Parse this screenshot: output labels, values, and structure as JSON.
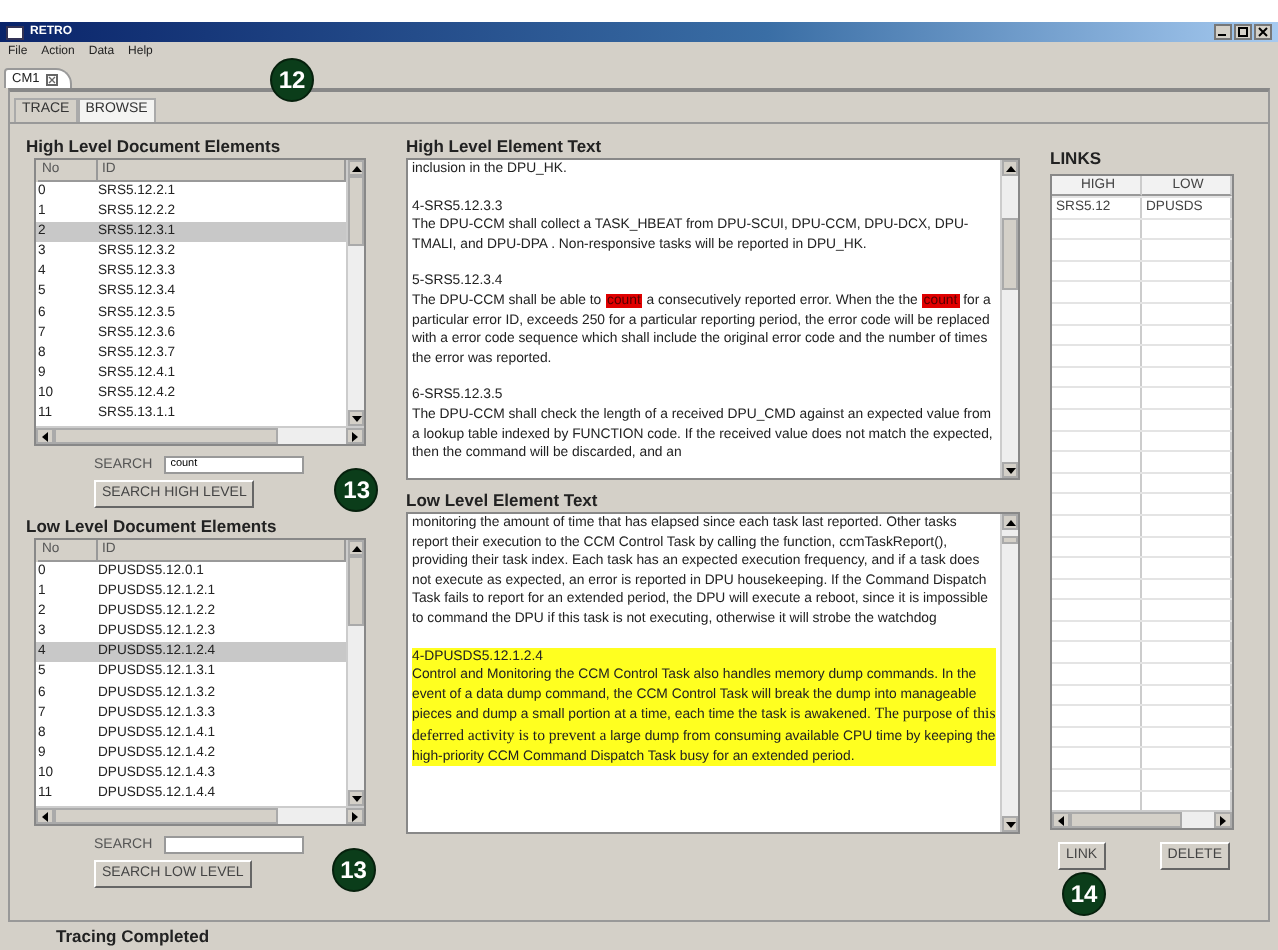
{
  "window": {
    "title": "RETRO"
  },
  "menu": [
    "File",
    "Action",
    "Data",
    "Help"
  ],
  "document_tabs": [
    {
      "label": "CM1",
      "selected": true
    }
  ],
  "document_tabs_callout": "12",
  "view_tabs": [
    {
      "label": "TRACE",
      "selected": false
    },
    {
      "label": "BROWSE",
      "selected": true
    }
  ],
  "high_level": {
    "heading": "High Level Document Elements",
    "columns": [
      "No",
      "ID"
    ],
    "rows": [
      {
        "no": "0",
        "id": "SRS5.12.2.1",
        "selected": false
      },
      {
        "no": "1",
        "id": "SRS5.12.2.2",
        "selected": false
      },
      {
        "no": "2",
        "id": "SRS5.12.3.1",
        "selected": true
      },
      {
        "no": "3",
        "id": "SRS5.12.3.2",
        "selected": false
      },
      {
        "no": "4",
        "id": "SRS5.12.3.3",
        "selected": false
      },
      {
        "no": "5",
        "id": "SRS5.12.3.4",
        "selected": false
      },
      {
        "no": "6",
        "id": "SRS5.12.3.5",
        "selected": false
      },
      {
        "no": "7",
        "id": "SRS5.12.3.6",
        "selected": false
      },
      {
        "no": "8",
        "id": "SRS5.12.3.7",
        "selected": false
      },
      {
        "no": "9",
        "id": "SRS5.12.4.1",
        "selected": false
      },
      {
        "no": "10",
        "id": "SRS5.12.4.2",
        "selected": false
      },
      {
        "no": "11",
        "id": "SRS5.13.1.1",
        "selected": false
      }
    ],
    "search_label": "SEARCH",
    "search_value": "count",
    "button": "SEARCH HIGH LEVEL",
    "callout": "13"
  },
  "high_text": {
    "heading": "High Level Element Text",
    "paragraphs": [
      {
        "selected": false,
        "segments": [
          {
            "kind": "plain",
            "text": "inclusion in the DPU_HK."
          }
        ]
      },
      {
        "selected": false,
        "heading": "4-SRS5.12.3.3",
        "segments": [
          {
            "kind": "plain",
            "text": "The DPU-CCM shall collect a TASK_HBEAT from  DPU-SCUI, DPU-CCM, DPU-DCX, DPU-TMALI, and DPU-DPA .  Non-responsive tasks will be reported in DPU_HK."
          }
        ]
      },
      {
        "selected": false,
        "heading": "5-SRS5.12.3.4",
        "segments": [
          {
            "kind": "plain",
            "text": "The DPU-CCM shall be able to "
          },
          {
            "kind": "match",
            "text": "count"
          },
          {
            "kind": "plain",
            "text": " a consecutively reported error.  When the the "
          },
          {
            "kind": "match",
            "text": "count"
          },
          {
            "kind": "plain",
            "text": " for a particular error ID, exceeds 250 for a particular reporting period, the error code will be replaced with a error code sequence which shall include the original error code and the number of times the error was reported."
          }
        ]
      },
      {
        "selected": false,
        "heading": "6-SRS5.12.3.5",
        "segments": [
          {
            "kind": "plain",
            "text": "The DPU-CCM shall check the length of a received DPU_CMD against an expected value from a lookup table indexed by FUNCTION code.  If the received value does not match the expected, then the command will be discarded, and an"
          }
        ]
      }
    ]
  },
  "low_level": {
    "heading": "Low Level Document Elements",
    "columns": [
      "No",
      "ID"
    ],
    "rows": [
      {
        "no": "0",
        "id": "DPUSDS5.12.0.1",
        "selected": false
      },
      {
        "no": "1",
        "id": "DPUSDS5.12.1.2.1",
        "selected": false
      },
      {
        "no": "2",
        "id": "DPUSDS5.12.1.2.2",
        "selected": false
      },
      {
        "no": "3",
        "id": "DPUSDS5.12.1.2.3",
        "selected": false
      },
      {
        "no": "4",
        "id": "DPUSDS5.12.1.2.4",
        "selected": true
      },
      {
        "no": "5",
        "id": "DPUSDS5.12.1.3.1",
        "selected": false
      },
      {
        "no": "6",
        "id": "DPUSDS5.12.1.3.2",
        "selected": false
      },
      {
        "no": "7",
        "id": "DPUSDS5.12.1.3.3",
        "selected": false
      },
      {
        "no": "8",
        "id": "DPUSDS5.12.1.4.1",
        "selected": false
      },
      {
        "no": "9",
        "id": "DPUSDS5.12.1.4.2",
        "selected": false
      },
      {
        "no": "10",
        "id": "DPUSDS5.12.1.4.3",
        "selected": false
      },
      {
        "no": "11",
        "id": "DPUSDS5.12.1.4.4",
        "selected": false
      }
    ],
    "search_label": "SEARCH",
    "button": "SEARCH LOW LEVEL",
    "callout": "13"
  },
  "low_text": {
    "heading": "Low Level Element Text",
    "paragraphs": [
      {
        "selected": false,
        "segments": [
          {
            "kind": "plain",
            "text": "monitoring the amount of time that has elapsed since each task last reported. Other tasks report their execution to the CCM Control Task by calling the function, ccmTaskReport(), providing their task index.  Each task has an expected execution frequency, and if a task does not execute as expected, an error is reported in DPU housekeeping.  If the Command Dispatch Task fails to report for an extended period, the DPU will execute a reboot, since it is impossible to command the DPU if this task is not executing, otherwise it will strobe the watchdog"
          }
        ]
      },
      {
        "selected": true,
        "heading": "4-DPUSDS5.12.1.2.4",
        "segments": [
          {
            "kind": "plain",
            "text": "Control and Monitoring   the CCM Control Task also handles memory dump commands.  In the event of a data dump command, the CCM Control Task will break the dump into manageable pieces and dump a small portion at a time, each time the task is awakened. "
          },
          {
            "kind": "serif",
            "text": "The purpose of this deferred activity is to prevent a"
          },
          {
            "kind": "plain",
            "text": " large dump from consuming available CPU time by keeping the high-priority CCM Command Dispatch Task busy for an extended period."
          }
        ]
      }
    ]
  },
  "links": {
    "heading": "LINKS",
    "columns": [
      "HIGH",
      "LOW"
    ],
    "rows": [
      [
        "SRS5.12",
        "DPUSDS"
      ]
    ],
    "buttons": [
      "LINK",
      "DELETE"
    ],
    "callout": "14"
  },
  "status_bar": "Tracing Completed"
}
